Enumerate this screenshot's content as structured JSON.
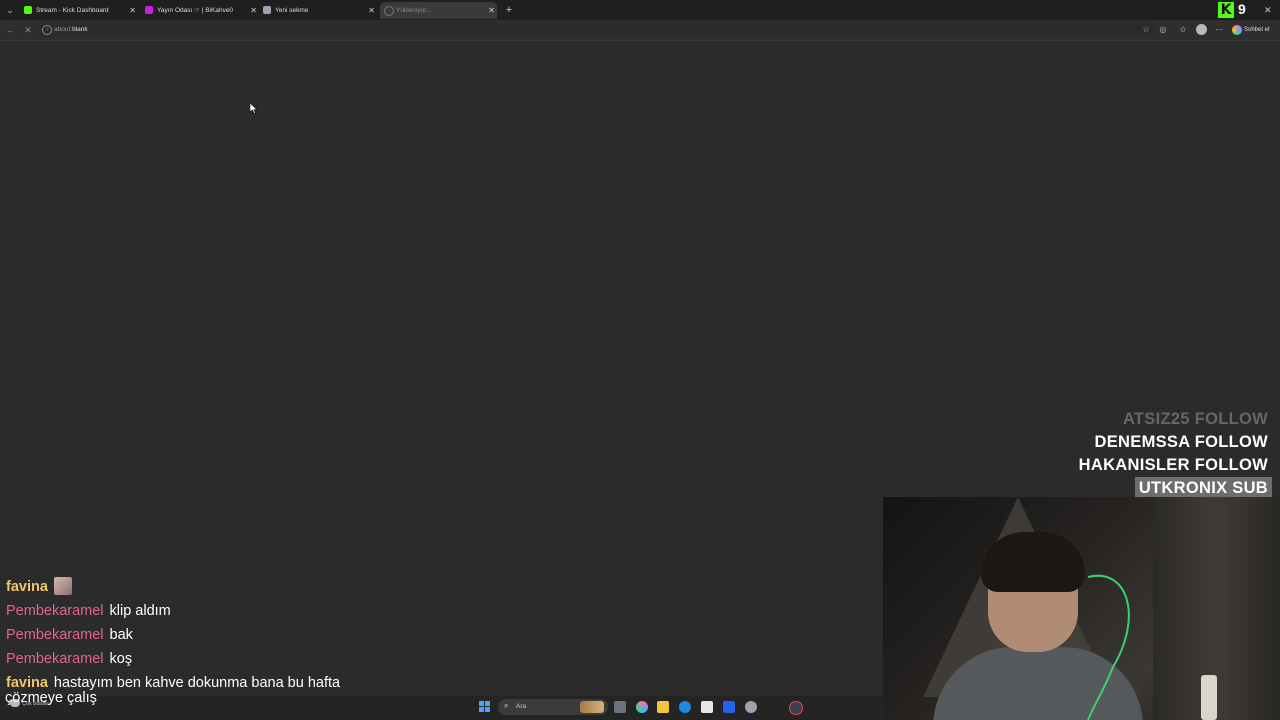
{
  "browser": {
    "tabs": [
      {
        "title": "Stream - Kick Dashboard",
        "favicon_color": "#53fc18"
      },
      {
        "title": "Yayın Odası ☞ | BiKahve0",
        "favicon_color": "#c026d3"
      },
      {
        "title": "Yeni sekme",
        "favicon_color": "#9ca3af"
      },
      {
        "title": "Yükleniyor...",
        "favicon_color": "#555555"
      }
    ],
    "address": {
      "prefix": "about:",
      "value": "blank"
    },
    "copilot_label": "Sohbet et"
  },
  "overlay": {
    "kick_logo": "K",
    "kick_count": "9"
  },
  "alerts": [
    {
      "text": "ATSIZ25  FOLLOW",
      "style": "faded"
    },
    {
      "text": "DENEMSSA  FOLLOW",
      "style": "normal"
    },
    {
      "text": "HAKANISLER  FOLLOW",
      "style": "normal"
    },
    {
      "text": "UTKRONIX  SUB",
      "style": "highlight"
    }
  ],
  "chat": [
    {
      "user": "favina",
      "color": "yellow",
      "text": "",
      "emote": true
    },
    {
      "user": "Pembekaramel",
      "color": "pink",
      "text": "klip aldım"
    },
    {
      "user": "Pembekaramel",
      "color": "pink",
      "text": "bak"
    },
    {
      "user": "Pembekaramel",
      "color": "pink",
      "text": "koş"
    },
    {
      "user": "favina",
      "color": "yellow",
      "text": "hastayım ben kahve dokunma bana bu hafta"
    }
  ],
  "chat_continuation": "çözmeye çalış",
  "taskbar": {
    "weather": "Çok bulutlu",
    "search_placeholder": "Ara"
  }
}
